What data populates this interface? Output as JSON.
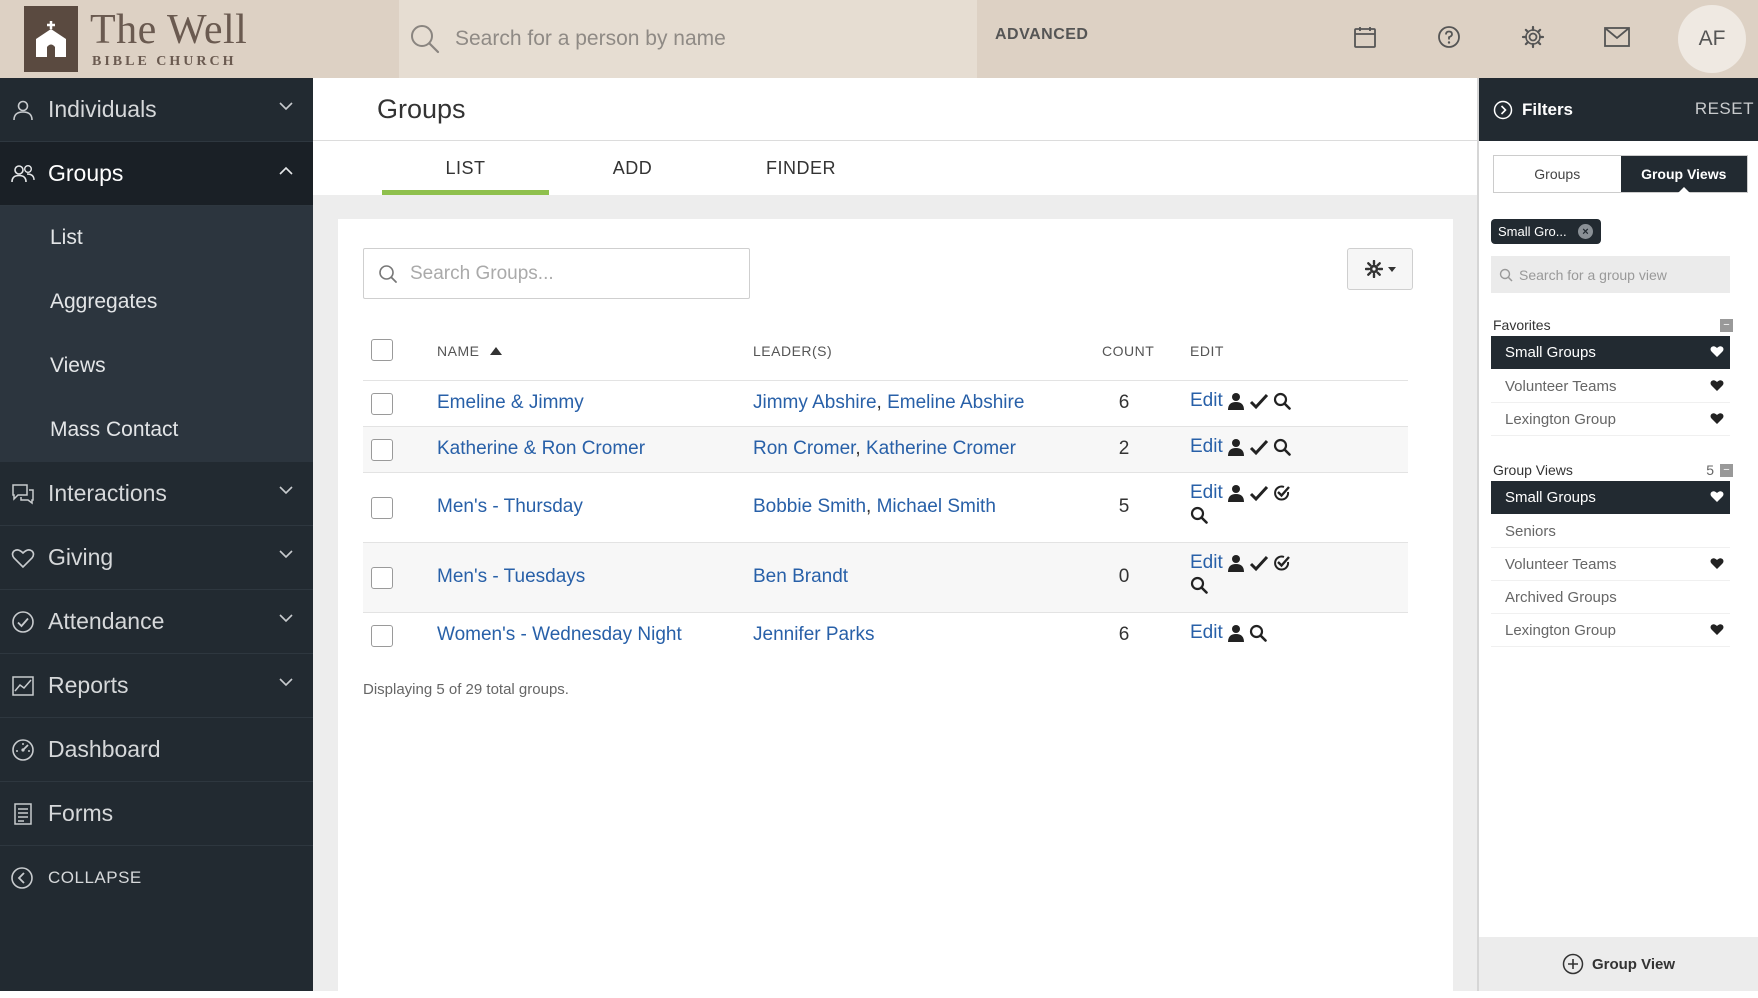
{
  "brand": {
    "name": "The Well",
    "subtitle": "BIBLE CHURCH"
  },
  "header": {
    "search_placeholder": "Search for a person by name",
    "advanced_label": "ADVANCED",
    "avatar_initials": "AF",
    "icons": [
      "calendar-icon",
      "help-icon",
      "gear-icon",
      "mail-icon"
    ]
  },
  "sidebar": {
    "items": [
      {
        "label": "Individuals",
        "icon": "person-icon",
        "expanded": false
      },
      {
        "label": "Groups",
        "icon": "people-icon",
        "expanded": true,
        "children": [
          "List",
          "Aggregates",
          "Views",
          "Mass Contact"
        ]
      },
      {
        "label": "Interactions",
        "icon": "chat-icon",
        "expanded": false
      },
      {
        "label": "Giving",
        "icon": "heart-icon",
        "expanded": false
      },
      {
        "label": "Attendance",
        "icon": "check-circle-icon",
        "expanded": false
      },
      {
        "label": "Reports",
        "icon": "chart-icon",
        "expanded": false
      },
      {
        "label": "Dashboard",
        "icon": "dashboard-icon"
      },
      {
        "label": "Forms",
        "icon": "form-icon"
      }
    ],
    "collapse_label": "COLLAPSE"
  },
  "main": {
    "title": "Groups",
    "tabs": [
      "LIST",
      "ADD",
      "FINDER"
    ],
    "active_tab": "LIST",
    "search_placeholder": "Search Groups...",
    "columns": {
      "name": "NAME",
      "leaders": "LEADER(S)",
      "count": "COUNT",
      "edit": "EDIT"
    },
    "sort": {
      "column": "NAME",
      "direction": "ascending"
    },
    "rows": [
      {
        "name": "Emeline & Jimmy",
        "leaders": [
          "Jimmy Abshire",
          "Emeline Abshire"
        ],
        "count": "6",
        "edit": "Edit"
      },
      {
        "name": "Katherine & Ron Cromer",
        "leaders": [
          "Ron Cromer",
          "Katherine Cromer"
        ],
        "count": "2",
        "edit": "Edit"
      },
      {
        "name": "Men's - Thursday",
        "leaders": [
          "Bobbie Smith",
          "Michael Smith"
        ],
        "count": "5",
        "edit": "Edit"
      },
      {
        "name": "Men's - Tuesdays",
        "leaders": [
          "Ben Brandt"
        ],
        "count": "0",
        "edit": "Edit"
      },
      {
        "name": "Women's - Wednesday Night",
        "leaders": [
          "Jennifer Parks"
        ],
        "count": "6",
        "edit": "Edit"
      }
    ],
    "footer": "Displaying 5 of 29 total groups.",
    "link_color": "#2860a8"
  },
  "filters": {
    "title": "Filters",
    "reset_label": "RESET",
    "segments": [
      "Groups",
      "Group Views"
    ],
    "active_segment": "Group Views",
    "chip_label": "Small Gro...",
    "search_placeholder": "Search for a group view",
    "favorites": {
      "title": "Favorites",
      "items": [
        {
          "label": "Small Groups",
          "selected": true,
          "favorite": true
        },
        {
          "label": "Volunteer Teams",
          "selected": false,
          "favorite": true
        },
        {
          "label": "Lexington Group",
          "selected": false,
          "favorite": true
        }
      ]
    },
    "group_views": {
      "title": "Group Views",
      "count": "5",
      "items": [
        {
          "label": "Small Groups",
          "selected": true,
          "favorite": true
        },
        {
          "label": "Seniors",
          "selected": false,
          "favorite": false
        },
        {
          "label": "Volunteer Teams",
          "selected": false,
          "favorite": true
        },
        {
          "label": "Archived Groups",
          "selected": false,
          "favorite": false
        },
        {
          "label": "Lexington Group",
          "selected": false,
          "favorite": true
        }
      ]
    },
    "add_view_label": "Group View"
  },
  "colors": {
    "sidebar_bg": "#222a31",
    "header_bg": "#ddd1c4",
    "tab_accent": "#8fc04d",
    "link": "#2860a8"
  }
}
